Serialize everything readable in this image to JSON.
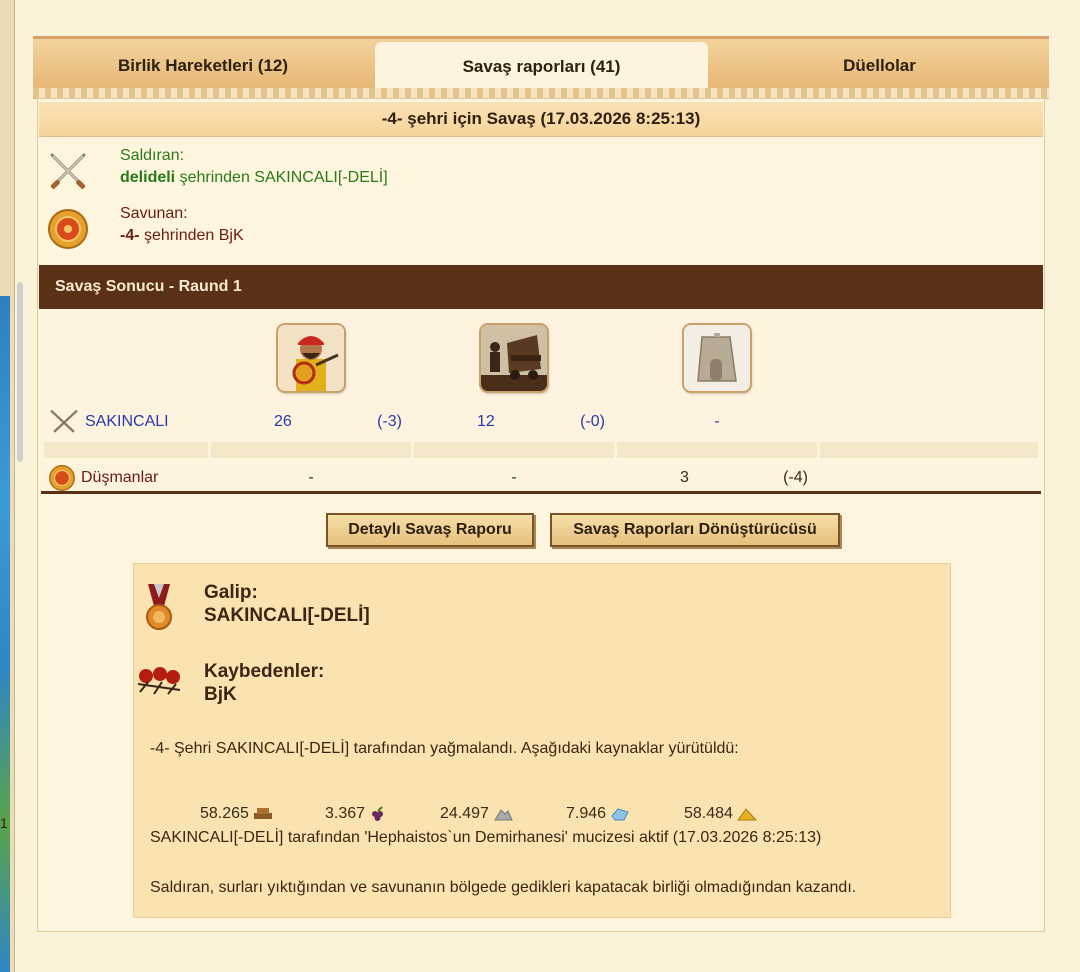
{
  "tabs": [
    {
      "label": "Birlik Hareketleri (12)"
    },
    {
      "label": "Savaş raporları (41)"
    },
    {
      "label": "Düellolar"
    }
  ],
  "report": {
    "title": "-4- şehri için Savaş (17.03.2026 8:25:13)",
    "attacker": {
      "role": "Saldıran:",
      "city": "delideli",
      "rest": " şehrinden SAKINCALI[-DELİ]"
    },
    "defender": {
      "role": "Savunan:",
      "city": "-4-",
      "rest": " şehrinden BjK"
    },
    "result_title": "Savaş Sonucu - Raund 1",
    "rows": [
      {
        "name": "SAKINCALI",
        "cells": [
          [
            "26",
            "(-3)"
          ],
          [
            "12",
            "(-0)"
          ],
          [
            "-",
            ""
          ]
        ]
      },
      {
        "name": "Düşmanlar",
        "cells": [
          [
            "-",
            ""
          ],
          [
            "-",
            ""
          ],
          [
            "3",
            "(-4)"
          ]
        ]
      }
    ]
  },
  "buttons": {
    "detail": "Detaylı Savaş Raporu",
    "converter": "Savaş Raporları Dönüştürücüsü"
  },
  "summary": {
    "winner_label": "Galip:",
    "winner": "SAKINCALI[-DELİ]",
    "losers_label": "Kaybedenler:",
    "losers": "BjK",
    "plunder_text": "-4- Şehri SAKINCALI[-DELİ] tarafından yağmalandı. Aşağıdaki kaynaklar yürütüldü:",
    "resources": [
      {
        "value": "58.265",
        "icon": "wood-icon"
      },
      {
        "value": "3.367",
        "icon": "wine-icon"
      },
      {
        "value": "24.497",
        "icon": "marble-icon"
      },
      {
        "value": "7.946",
        "icon": "crystal-icon"
      },
      {
        "value": "58.484",
        "icon": "sulfur-icon"
      }
    ],
    "wonder_text": "SAKINCALI[-DELİ] tarafından 'Hephaistos`un Demirhanesi' mucizesi aktif (17.03.2026 8:25:13)",
    "outcome_text": "Saldıran, surları yıktığından ve savunanın bölgede gedikleri kapatacak birliği olmadığından kazandı."
  },
  "left_edge_label": "1"
}
